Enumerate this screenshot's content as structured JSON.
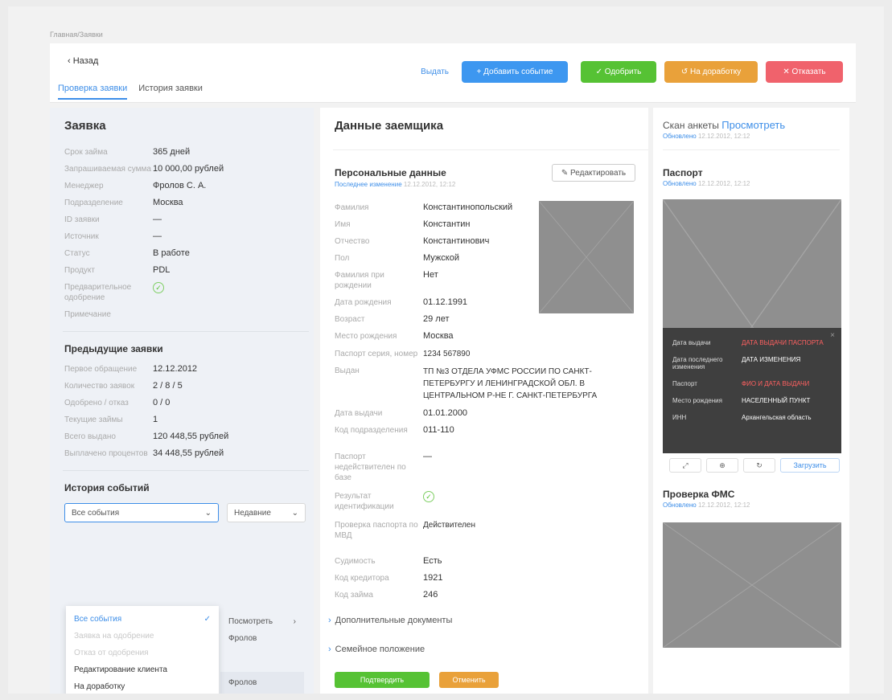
{
  "breadcrumb": "Главная/Заявки",
  "header": {
    "back": "‹ Назад",
    "tabs": [
      "Проверка заявки",
      "История заявки"
    ],
    "link": "Выдать",
    "buttons": {
      "add_event": "+ Добавить событие",
      "approve": "✓ Одобрить",
      "rework": "↺ На доработку",
      "reject": "✕ Отказать"
    }
  },
  "left": {
    "title": "Заявка",
    "fields": [
      {
        "k": "Срок займа",
        "v": "365 дней"
      },
      {
        "k": "Запрашиваемая сумма",
        "v": "10 000,00 рублей"
      },
      {
        "k": "Менеджер",
        "v": "Фролов С. А."
      },
      {
        "k": "Подразделение",
        "v": "Москва"
      },
      {
        "k": "ID заявки",
        "v": "—"
      },
      {
        "k": "Источник",
        "v": "—"
      },
      {
        "k": "Статус",
        "v": "В работе"
      },
      {
        "k": "Продукт",
        "v": "PDL"
      },
      {
        "k": "Предварительное одобрение",
        "v": ""
      },
      {
        "k": "Примечание",
        "v": ""
      }
    ],
    "prev_title": "Предыдущие заявки",
    "prev_fields": [
      {
        "k": "Первое обращение",
        "v": "12.12.2012"
      },
      {
        "k": "Количество заявок",
        "v": "2 / 8 / 5"
      },
      {
        "k": "Одобрено / отказ",
        "v": "0 / 0"
      },
      {
        "k": "Текущие займы",
        "v": "1"
      },
      {
        "k": "Всего выдано",
        "v": "120 448,55 рублей"
      },
      {
        "k": "Выплачено процентов",
        "v": "34 448,55 рублей"
      }
    ],
    "events_title": "История событий",
    "filter_placeholder": "Все события",
    "sort": "Недавние",
    "dropdown": [
      {
        "label": "Все события",
        "state": "active"
      },
      {
        "label": "Заявка на одобрение",
        "state": "disabled"
      },
      {
        "label": "Отказ от одобрения",
        "state": "disabled"
      },
      {
        "label": "Редактирование клиента",
        "state": "normal"
      },
      {
        "label": "На доработку",
        "state": "normal"
      }
    ],
    "side_list": [
      "Посмотреть",
      "Фролов",
      "Фролов"
    ]
  },
  "center": {
    "title": "Данные заемщика",
    "pd_title": "Персональные данные",
    "pd_meta_link": "Последнее изменение",
    "pd_meta_date": "12.12.2012, 12:12",
    "edit_btn": "✎ Редактировать",
    "fields": [
      {
        "k": "Фамилия",
        "v": "Константинопольский"
      },
      {
        "k": "Имя",
        "v": "Константин"
      },
      {
        "k": "Отчество",
        "v": "Константинович"
      },
      {
        "k": "Пол",
        "v": "Мужской"
      },
      {
        "k": "Фамилия при рождении",
        "v": "Нет"
      },
      {
        "k": "Дата рождения",
        "v": "01.12.1991"
      },
      {
        "k": "Возраст",
        "v": "29 лет"
      },
      {
        "k": "Место рождения",
        "v": "Москва"
      }
    ],
    "passport": [
      {
        "k": "Паспорт серия, номер",
        "v": "1234 567890",
        "cls": "red"
      },
      {
        "k": "Выдан",
        "v": "ТП №3 ОТДЕЛА УФМС РОССИИ ПО САНКТ-ПЕТЕРБУРГУ И ЛЕНИНГРАДСКОЙ ОБЛ. В ЦЕНТРАЛЬНОМ Р-НЕ Г. САНКТ-ПЕТЕРБУРГА",
        "cls": ""
      },
      {
        "k": "Дата выдачи",
        "v": "01.01.2000",
        "cls": ""
      },
      {
        "k": "Код подразделения",
        "v": "011-110",
        "cls": ""
      }
    ],
    "checks": [
      {
        "k": "Паспорт недействителен по базе",
        "v": "—",
        "cls": ""
      },
      {
        "k": "Результат идентификации",
        "v": "",
        "cls": "check"
      },
      {
        "k": "Проверка паспорта по МВД",
        "v": "Действителен",
        "cls": "green"
      }
    ],
    "extra": [
      {
        "k": "Судимость",
        "v": "Есть",
        "cls": "red"
      },
      {
        "k": "Код кредитора",
        "v": "1921",
        "cls": ""
      },
      {
        "k": "Код займа",
        "v": "246",
        "cls": ""
      }
    ],
    "section_docs": "Дополнительные документы",
    "section_family": "Семейное положение",
    "btn_save": "Подтвердить",
    "btn_cancel": "Отменить"
  },
  "right": {
    "face_label": "Скан анкеты",
    "face_link": "Просмотреть",
    "face_meta_link": "Обновлено",
    "face_meta_date": "12.12.2012, 12:12",
    "passport_title": "Паспорт",
    "passport_meta_link": "Обновлено",
    "passport_meta_date": "12.12.2012, 12:12",
    "overlay": [
      {
        "k": "Дата выдачи",
        "v": "ДАТА ВЫДАЧИ ПАСПОРТА",
        "cls": "red"
      },
      {
        "k": "Дата последнего изменения",
        "v": "ДАТА ИЗМЕНЕНИЯ",
        "cls": ""
      },
      {
        "k": "Паспорт",
        "v": "ФИО И ДАТА ВЫДАЧИ",
        "cls": "red"
      },
      {
        "k": "Место рождения",
        "v": "НАСЕЛЕННЫЙ ПУНКТ",
        "cls": ""
      },
      {
        "k": "ИНН",
        "v": "Архангельская область",
        "cls": ""
      }
    ],
    "tools": [
      "⤢",
      "⊕",
      "↻",
      "Загрузить"
    ],
    "fms_title": "Проверка ФМС",
    "fms_meta_link": "Обновлено",
    "fms_meta_date": "12.12.2012, 12:12"
  },
  "colors": {
    "accent": "#3d8ee8",
    "success": "#56c234",
    "warning": "#e9a13a",
    "danger": "#f0626c"
  }
}
